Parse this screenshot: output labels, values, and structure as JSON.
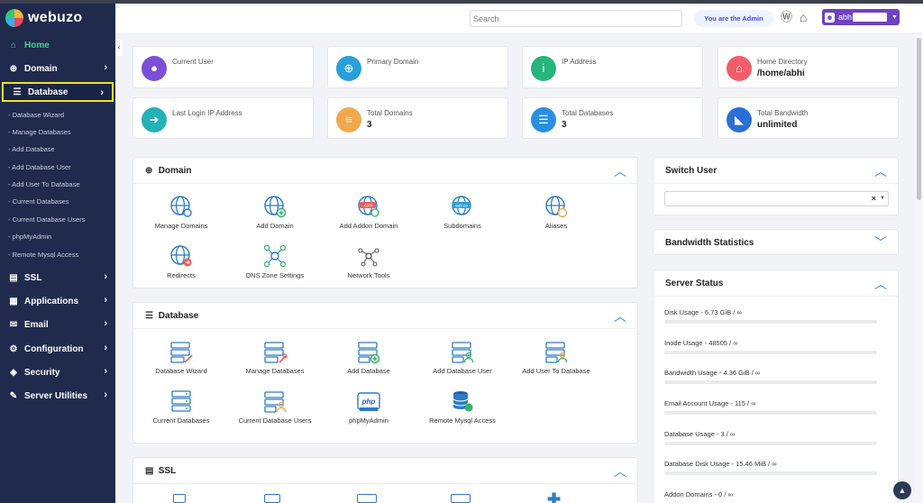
{
  "app": {
    "name": "webuzo"
  },
  "sidebar": {
    "home": "Home",
    "items": [
      {
        "label": "Domain"
      },
      {
        "label": "Database"
      },
      {
        "label": "SSL"
      },
      {
        "label": "Applications"
      },
      {
        "label": "Email"
      },
      {
        "label": "Configuration"
      },
      {
        "label": "Security"
      },
      {
        "label": "Server Utilities"
      }
    ],
    "database_sub": [
      "- Database Wizard",
      "- Manage Databases",
      "- Add Database",
      "- Add Database User",
      "- Add User To Database",
      "- Current Databases",
      "- Current Database Users",
      "- phpMyAdmin",
      "- Remote Mysql Access"
    ]
  },
  "header": {
    "search_placeholder": "Search",
    "admin_badge": "You are the Admin",
    "user_name": "abh"
  },
  "stats": [
    {
      "label": "Current User",
      "value": "",
      "color": "#7b4fd6"
    },
    {
      "label": "Primary Domain",
      "value": "",
      "color": "#2a9fd8"
    },
    {
      "label": "IP Address",
      "value": "",
      "color": "#26b57c"
    },
    {
      "label": "Home Directory",
      "value": "/home/abhi",
      "color": "#f25d6b"
    },
    {
      "label": "Last Login IP Address",
      "value": "",
      "color": "#24b1b8"
    },
    {
      "label": "Total Domains",
      "value": "3",
      "color": "#f0a94e"
    },
    {
      "label": "Total Databases",
      "value": "3",
      "color": "#2a8fe0"
    },
    {
      "label": "Total Bandwidth",
      "value": "unlimited",
      "color": "#2a6fd8"
    }
  ],
  "domain_panel": {
    "title": "Domain",
    "tools": [
      "Manage Domains",
      "Add Domain",
      "Add Addon Domain",
      "Subdomains",
      "Aliases",
      "Redirects",
      "DNS Zone Settings",
      "Network Tools"
    ]
  },
  "database_panel": {
    "title": "Database",
    "tools": [
      "Database Wizard",
      "Manage Databases",
      "Add Database",
      "Add Database User",
      "Add User To Database",
      "Current Databases",
      "Current Database Users",
      "phpMyAdmin",
      "Remote Mysql Access"
    ]
  },
  "ssl_panel": {
    "title": "SSL"
  },
  "switch_user": {
    "title": "Switch User"
  },
  "bandwidth": {
    "title": "Bandwidth Statistics"
  },
  "server_status": {
    "title": "Server Status",
    "rows": [
      {
        "label": "Disk Usage  -  6.73 GiB / ∞"
      },
      {
        "label": "Inode Usage  -  48505 / ∞"
      },
      {
        "label": "Bandwidth Usage  -  4.36 GiB / ∞"
      },
      {
        "label": "Email Account Usage  -  115 / ∞"
      },
      {
        "label": "Database Usage  -  3 / ∞"
      },
      {
        "label": "Database Disk Usage  -  15.46 MiB / ∞"
      },
      {
        "label": "Addon Domains  -  0 / ∞"
      }
    ]
  },
  "icons": {
    "text_tags": {
      "dotcom": ".com",
      "subdomain": "sub.co",
      "php": "php"
    }
  }
}
